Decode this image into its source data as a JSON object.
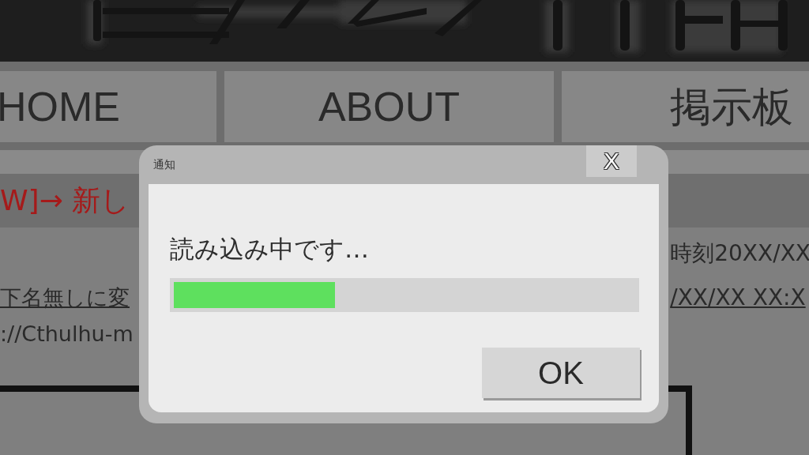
{
  "nav": {
    "tabs": [
      {
        "label": "HOME",
        "selected": false
      },
      {
        "label": "ABOUT",
        "selected": false
      },
      {
        "label": "掲示板",
        "selected": false
      }
    ]
  },
  "notice": {
    "text": "W]→ 新し"
  },
  "post": {
    "left_lines": [
      {
        "text": "下名無しに変",
        "underlined": true
      },
      {
        "text": "://Cthulhu-m",
        "underlined": false
      }
    ],
    "right_lines": [
      {
        "text": "時刻20XX/XX",
        "underlined": false
      },
      {
        "text": "/XX/XX XX:X",
        "underlined": true
      }
    ]
  },
  "dialog": {
    "title": "通知",
    "close": "X",
    "message": "読み込み中です…",
    "progress": {
      "level": 0.35
    },
    "button": "OK"
  }
}
